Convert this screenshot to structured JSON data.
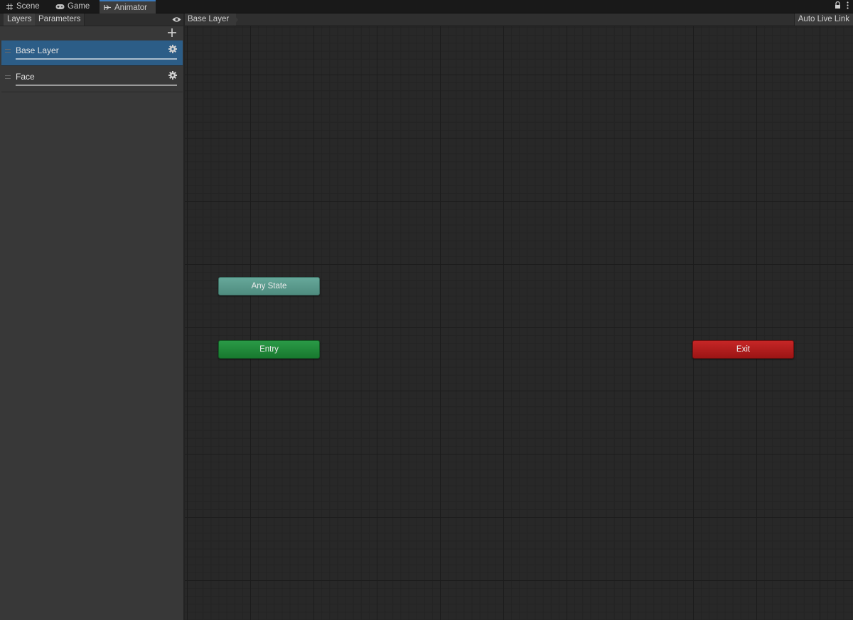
{
  "window": {
    "tabs": [
      {
        "label": "Scene",
        "icon": "grid-icon"
      },
      {
        "label": "Game",
        "icon": "gamepad-icon"
      },
      {
        "label": "Animator",
        "icon": "animator-icon"
      }
    ],
    "active_tab": "Animator"
  },
  "left_panel": {
    "tabs": [
      "Layers",
      "Parameters"
    ],
    "active_tab": "Layers",
    "layers": [
      {
        "name": "Base Layer",
        "selected": true
      },
      {
        "name": "Face",
        "selected": false
      }
    ]
  },
  "graph": {
    "breadcrumb": "Base Layer",
    "auto_live_link": "Auto Live Link",
    "nodes": {
      "any_state": "Any State",
      "entry": "Entry",
      "exit": "Exit"
    }
  },
  "colors": {
    "selection": "#2c5d87",
    "any_state": "#5a9a8c",
    "entry": "#1f8a3a",
    "exit": "#b01d1d",
    "tab_accent": "#3a79bb"
  }
}
